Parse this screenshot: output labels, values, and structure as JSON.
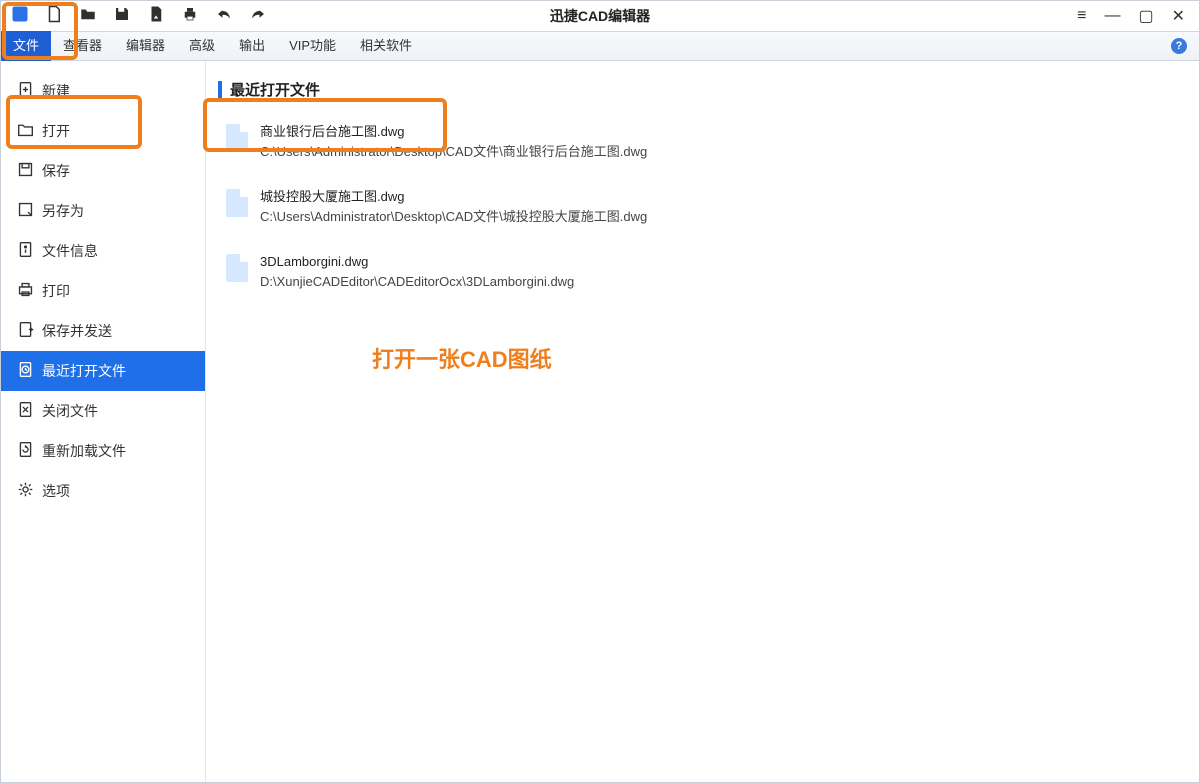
{
  "app": {
    "title": "迅捷CAD编辑器"
  },
  "menubar": {
    "items": [
      {
        "label": "文件",
        "active": true
      },
      {
        "label": "查看器"
      },
      {
        "label": "编辑器"
      },
      {
        "label": "高级"
      },
      {
        "label": "输出"
      },
      {
        "label": "VIP功能"
      },
      {
        "label": "相关软件"
      }
    ]
  },
  "sidebar": {
    "items": [
      {
        "label": "新建",
        "icon": "new"
      },
      {
        "label": "打开",
        "icon": "open"
      },
      {
        "label": "保存",
        "icon": "save"
      },
      {
        "label": "另存为",
        "icon": "saveas"
      },
      {
        "label": "文件信息",
        "icon": "info"
      },
      {
        "label": "打印",
        "icon": "print"
      },
      {
        "label": "保存并发送",
        "icon": "send"
      },
      {
        "label": "最近打开文件",
        "icon": "recent",
        "selected": true
      },
      {
        "label": "关闭文件",
        "icon": "close"
      },
      {
        "label": "重新加载文件",
        "icon": "reload"
      },
      {
        "label": "选项",
        "icon": "options"
      }
    ]
  },
  "content": {
    "section_title": "最近打开文件",
    "files": [
      {
        "name": "商业银行后台施工图.dwg",
        "path": "C:\\Users\\Administrator\\Desktop\\CAD文件\\商业银行后台施工图.dwg"
      },
      {
        "name": "城投控股大厦施工图.dwg",
        "path": "C:\\Users\\Administrator\\Desktop\\CAD文件\\城投控股大厦施工图.dwg"
      },
      {
        "name": "3DLamborgini.dwg",
        "path": "D:\\XunjieCADEditor\\CADEditorOcx\\3DLamborgini.dwg"
      }
    ]
  },
  "annotation": {
    "hint": "打开一张CAD图纸"
  }
}
